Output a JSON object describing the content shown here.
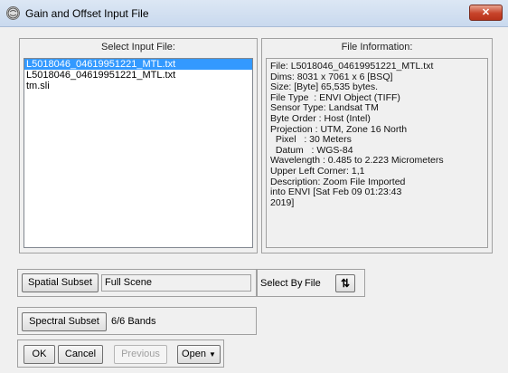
{
  "window": {
    "title": "Gain and Offset Input File",
    "close_label": "✕"
  },
  "input_panel": {
    "label": "Select Input File:",
    "files": [
      "L5018046_04619951221_MTL.txt",
      "L5018046_04619951221_MTL.txt",
      "tm.sli"
    ],
    "selected_index": 0
  },
  "info_panel": {
    "label": "File Information:",
    "lines": [
      "File: L5018046_04619951221_MTL.txt",
      "Dims: 8031 x 7061 x 6 [BSQ]",
      "Size: [Byte] 65,535 bytes.",
      "File Type  : ENVI Object (TIFF)",
      "Sensor Type: Landsat TM",
      "Byte Order : Host (Intel)",
      "Projection : UTM, Zone 16 North",
      "  Pixel   : 30 Meters",
      "  Datum   : WGS-84",
      "Wavelength : 0.485 to 2.223 Micrometers",
      "Upper Left Corner: 1,1",
      "Description: Zoom File Imported",
      "into ENVI [Sat Feb 09 01:23:43",
      "2019]"
    ]
  },
  "spatial": {
    "button_label": "Spatial Subset",
    "value": "Full Scene"
  },
  "select_by": {
    "label": "Select By",
    "value": "File",
    "icon": "sort-arrows-icon"
  },
  "spectral": {
    "button_label": "Spectral Subset",
    "value": "6/6 Bands"
  },
  "actions": {
    "ok_label": "OK",
    "cancel_label": "Cancel",
    "previous_label": "Previous",
    "open_label": "Open",
    "open_icon": "dropdown-triangle-icon"
  }
}
